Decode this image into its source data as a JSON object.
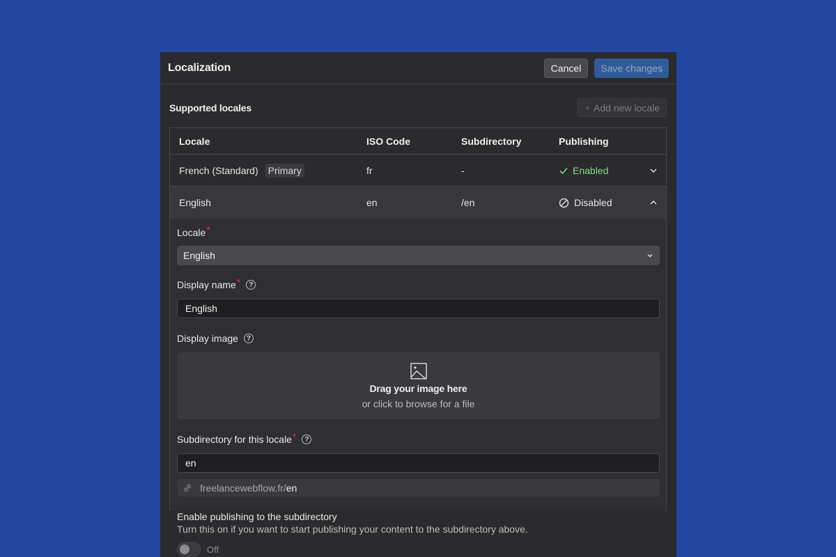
{
  "header": {
    "title": "Localization",
    "cancel_label": "Cancel",
    "save_label": "Save changes"
  },
  "section": {
    "title": "Supported locales",
    "add_label": "Add new locale"
  },
  "table": {
    "columns": [
      "Locale",
      "ISO Code",
      "Subdirectory",
      "Publishing"
    ],
    "rows": [
      {
        "locale": "French (Standard)",
        "badge": "Primary",
        "iso": "fr",
        "subdir": "-",
        "publishing": "Enabled"
      },
      {
        "locale": "English",
        "iso": "en",
        "subdir": "/en",
        "publishing": "Disabled"
      }
    ]
  },
  "form": {
    "locale_label": "Locale",
    "locale_value": "English",
    "display_name_label": "Display name",
    "display_name_value": "English",
    "display_image_label": "Display image",
    "drop_title": "Drag your image here",
    "drop_sub": "or click to browse for a file",
    "subdir_label": "Subdirectory for this locale",
    "subdir_value": "en",
    "url_base": "freelancewebflow.fr/",
    "url_suffix": "en",
    "publish_title": "Enable publishing to the subdirectory",
    "publish_desc": "Turn this on if you want to start publishing your content to the subdirectory above.",
    "toggle_label": "Off"
  },
  "colors": {
    "background": "#2348a2",
    "panel": "#2b2a2d",
    "accent": "#2f5b98",
    "enabled": "#7fdc8a",
    "required": "#e0394a"
  }
}
